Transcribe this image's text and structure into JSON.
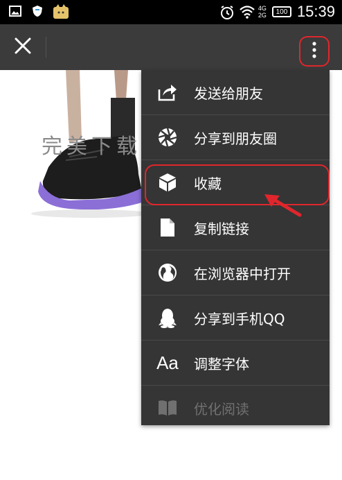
{
  "status_bar": {
    "time": "15:39",
    "battery": "100",
    "network_top": "4G",
    "network_bottom": "2G",
    "icons": [
      "image-notification-icon",
      "shield-icon",
      "cat-app-icon",
      "alarm-icon",
      "wifi-icon",
      "signal-icon",
      "battery-icon"
    ]
  },
  "toolbar": {
    "close_icon": "close-icon",
    "more_icon": "more-vertical-icon"
  },
  "content": {
    "watermark": "完美下载"
  },
  "menu": {
    "items": [
      {
        "label": "发送给朋友",
        "icon": "share-forward-icon"
      },
      {
        "label": "分享到朋友圈",
        "icon": "moments-aperture-icon"
      },
      {
        "label": "收藏",
        "icon": "cube-favorite-icon"
      },
      {
        "label": "复制链接",
        "icon": "copy-link-icon"
      },
      {
        "label": "在浏览器中打开",
        "icon": "globe-icon"
      },
      {
        "label": "分享到手机QQ",
        "icon": "qq-penguin-icon"
      },
      {
        "label": "调整字体",
        "icon": "font-aa-icon",
        "icon_text": "Aa"
      },
      {
        "label": "优化阅读",
        "icon": "book-icon"
      }
    ]
  },
  "colors": {
    "status_bar": "#000000",
    "toolbar": "#3b3b3b",
    "menu_bg": "#353535",
    "highlight": "#e0262c",
    "shoe_purple": "#8b6fd6"
  }
}
